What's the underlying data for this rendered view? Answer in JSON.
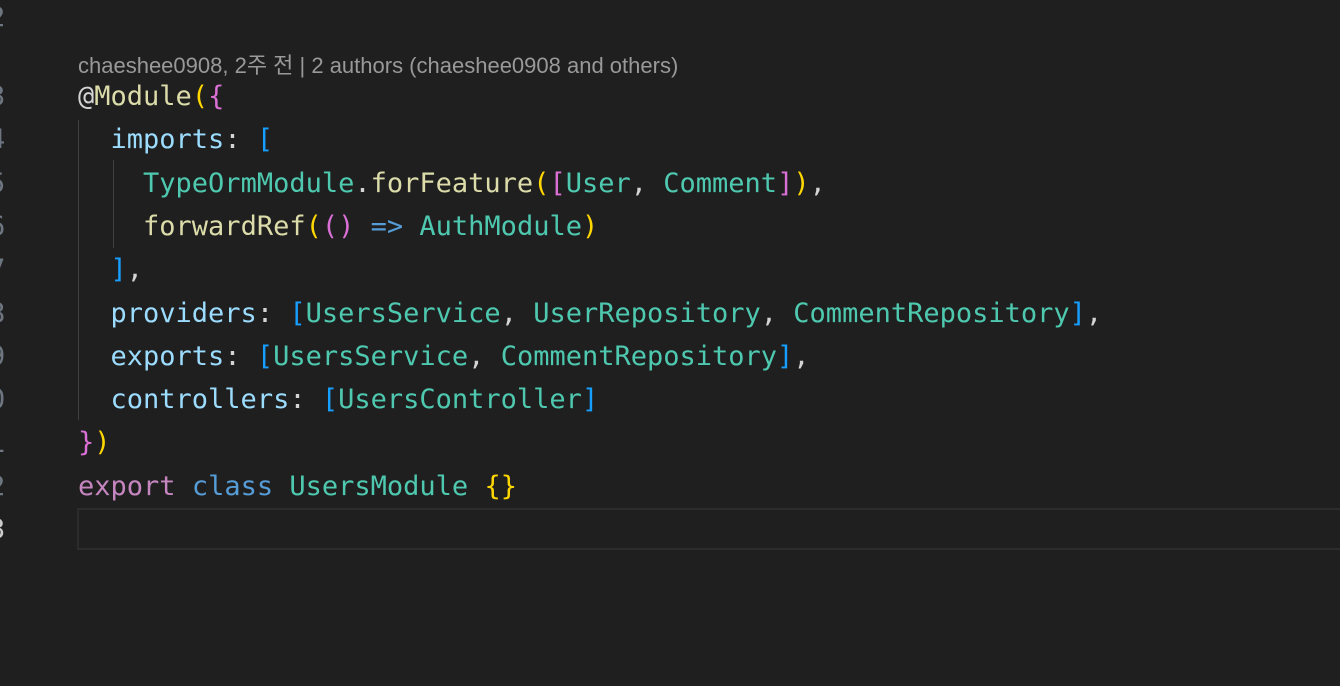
{
  "editor": {
    "codelens": "chaeshee0908, 2주 전 | 2 authors (chaeshee0908 and others)",
    "gutter": [
      {
        "label": "2",
        "active": false
      },
      {
        "label": "3",
        "active": false
      },
      {
        "label": "4",
        "active": false
      },
      {
        "label": "5",
        "active": false
      },
      {
        "label": "6",
        "active": false
      },
      {
        "label": "7",
        "active": false
      },
      {
        "label": "8",
        "active": false
      },
      {
        "label": "9",
        "active": false
      },
      {
        "label": "0",
        "active": false
      },
      {
        "label": "1",
        "active": false
      },
      {
        "label": "2",
        "active": false
      },
      {
        "label": "3",
        "active": true
      }
    ],
    "lines": [
      {
        "tokens": [
          {
            "t": "@",
            "c": "at"
          },
          {
            "t": "Module",
            "c": "dec"
          },
          {
            "t": "(",
            "c": "br1"
          },
          {
            "t": "{",
            "c": "br2"
          }
        ]
      },
      {
        "tokens": [
          {
            "t": "  ",
            "c": "punct"
          },
          {
            "t": "imports",
            "c": "prop"
          },
          {
            "t": ": ",
            "c": "punct"
          },
          {
            "t": "[",
            "c": "br3"
          }
        ]
      },
      {
        "tokens": [
          {
            "t": "    ",
            "c": "punct"
          },
          {
            "t": "TypeOrmModule",
            "c": "type"
          },
          {
            "t": ".",
            "c": "punct"
          },
          {
            "t": "forFeature",
            "c": "fn"
          },
          {
            "t": "(",
            "c": "br1"
          },
          {
            "t": "[",
            "c": "br2"
          },
          {
            "t": "User",
            "c": "type"
          },
          {
            "t": ", ",
            "c": "punct"
          },
          {
            "t": "Comment",
            "c": "type"
          },
          {
            "t": "]",
            "c": "br2"
          },
          {
            "t": ")",
            "c": "br1"
          },
          {
            "t": ",",
            "c": "punct"
          }
        ]
      },
      {
        "tokens": [
          {
            "t": "    ",
            "c": "punct"
          },
          {
            "t": "forwardRef",
            "c": "fn"
          },
          {
            "t": "(",
            "c": "br1"
          },
          {
            "t": "()",
            "c": "br2"
          },
          {
            "t": " => ",
            "c": "kw2"
          },
          {
            "t": "AuthModule",
            "c": "type"
          },
          {
            "t": ")",
            "c": "br1"
          }
        ]
      },
      {
        "tokens": [
          {
            "t": "  ",
            "c": "punct"
          },
          {
            "t": "]",
            "c": "br3"
          },
          {
            "t": ",",
            "c": "punct"
          }
        ]
      },
      {
        "tokens": [
          {
            "t": "  ",
            "c": "punct"
          },
          {
            "t": "providers",
            "c": "prop"
          },
          {
            "t": ": ",
            "c": "punct"
          },
          {
            "t": "[",
            "c": "br3"
          },
          {
            "t": "UsersService",
            "c": "type"
          },
          {
            "t": ", ",
            "c": "punct"
          },
          {
            "t": "UserRepository",
            "c": "type"
          },
          {
            "t": ", ",
            "c": "punct"
          },
          {
            "t": "CommentRepository",
            "c": "type"
          },
          {
            "t": "]",
            "c": "br3"
          },
          {
            "t": ",",
            "c": "punct"
          }
        ]
      },
      {
        "tokens": [
          {
            "t": "  ",
            "c": "punct"
          },
          {
            "t": "exports",
            "c": "prop"
          },
          {
            "t": ": ",
            "c": "punct"
          },
          {
            "t": "[",
            "c": "br3"
          },
          {
            "t": "UsersService",
            "c": "type"
          },
          {
            "t": ", ",
            "c": "punct"
          },
          {
            "t": "CommentRepository",
            "c": "type"
          },
          {
            "t": "]",
            "c": "br3"
          },
          {
            "t": ",",
            "c": "punct"
          }
        ]
      },
      {
        "tokens": [
          {
            "t": "  ",
            "c": "punct"
          },
          {
            "t": "controllers",
            "c": "prop"
          },
          {
            "t": ": ",
            "c": "punct"
          },
          {
            "t": "[",
            "c": "br3"
          },
          {
            "t": "UsersController",
            "c": "type"
          },
          {
            "t": "]",
            "c": "br3"
          }
        ]
      },
      {
        "tokens": [
          {
            "t": "}",
            "c": "br2"
          },
          {
            "t": ")",
            "c": "br1"
          }
        ]
      },
      {
        "tokens": [
          {
            "t": "export",
            "c": "kw"
          },
          {
            "t": " ",
            "c": "punct"
          },
          {
            "t": "class",
            "c": "kw2"
          },
          {
            "t": " ",
            "c": "punct"
          },
          {
            "t": "UsersModule",
            "c": "type"
          },
          {
            "t": " ",
            "c": "punct"
          },
          {
            "t": "{}",
            "c": "br1"
          }
        ]
      },
      {
        "tokens": []
      }
    ],
    "colors": {
      "background": "#1f1f1f",
      "decorator": "#dcdcaa",
      "type": "#4ec9b0",
      "property": "#9cdcfe",
      "keyword_export": "#c586c0",
      "keyword_class": "#569cd6",
      "bracket_level1": "#ffd700",
      "bracket_level2": "#da70d6",
      "bracket_level3": "#179fff"
    }
  }
}
